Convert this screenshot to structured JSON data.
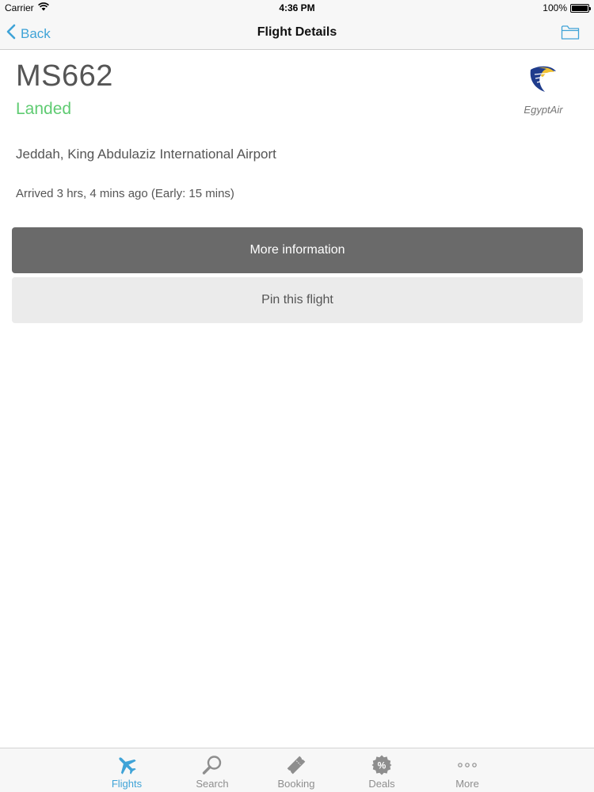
{
  "status_bar": {
    "carrier": "Carrier",
    "time": "4:36 PM",
    "battery": "100%",
    "battery_level": 1.0
  },
  "nav": {
    "back_label": "Back",
    "title": "Flight Details",
    "right_icon": "folder-icon"
  },
  "flight": {
    "number": "MS662",
    "status": "Landed",
    "status_color": "#5fcb72",
    "airline": "EgyptAir",
    "airport": "Jeddah, King Abdulaziz International Airport",
    "arrival": "Arrived  3 hrs, 4 mins ago (Early:  15 mins)"
  },
  "actions": {
    "more_info": "More information",
    "pin": "Pin this flight"
  },
  "tabs": [
    {
      "label": "Flights",
      "icon": "airplane-icon",
      "active": true
    },
    {
      "label": "Search",
      "icon": "search-icon",
      "active": false
    },
    {
      "label": "Booking",
      "icon": "ticket-icon",
      "active": false
    },
    {
      "label": "Deals",
      "icon": "percent-badge-icon",
      "active": false
    },
    {
      "label": "More",
      "icon": "more-dots-icon",
      "active": false
    }
  ],
  "colors": {
    "accent": "#3fa3d7",
    "tab_inactive": "#8e8e8e"
  }
}
